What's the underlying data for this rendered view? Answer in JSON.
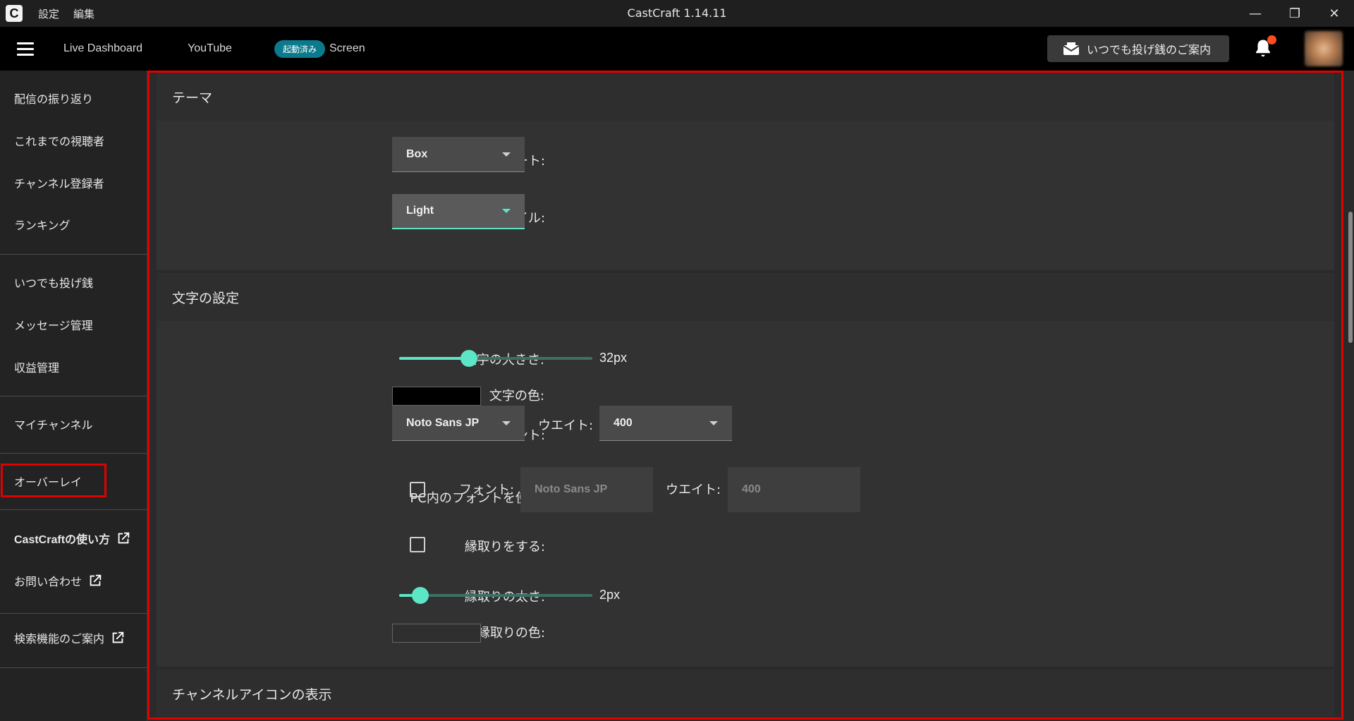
{
  "titlebar": {
    "logo_letter": "C",
    "menus": [
      "設定",
      "編集"
    ],
    "title": "CastCraft 1.14.11",
    "minimize": "—",
    "restore": "❐",
    "close": "✕"
  },
  "navbar": {
    "links": {
      "dashboard": "Live Dashboard",
      "youtube": "YouTube",
      "screen_badge": "起動済み",
      "screen": "Screen"
    },
    "donation_button": "いつでも投げ銭のご案内",
    "notification_dot_color": "#ff4d1f"
  },
  "sidebar": {
    "items": [
      {
        "label": "配信の振り返り"
      },
      {
        "label": "これまでの視聴者"
      },
      {
        "label": "チャンネル登録者"
      },
      {
        "label": "ランキング"
      },
      {
        "label": "いつでも投げ銭"
      },
      {
        "label": "メッセージ管理"
      },
      {
        "label": "収益管理"
      },
      {
        "label": "マイチャンネル"
      },
      {
        "label": "オーバーレイ"
      },
      {
        "label": "CastCraftの使い方"
      },
      {
        "label": "お問い合わせ"
      },
      {
        "label": "検索機能のご案内"
      }
    ]
  },
  "theme": {
    "title": "テーマ",
    "base_template_label": "ベーステンプレート:",
    "base_template_value": "Box",
    "base_style_label": "ベーススタイル:",
    "base_style_value": "Light"
  },
  "text_settings": {
    "title": "文字の設定",
    "size_label": "文字の大きさ:",
    "size_value": "32px",
    "size_fraction": 0.36,
    "color_label": "文字の色:",
    "text_color": "#000000",
    "font_label": "フォント:",
    "font_value": "Noto Sans JP",
    "weight_label": "ウエイト:",
    "weight_value": "400",
    "pc_font_label": "PC内のフォントを使う:",
    "pc_font_font_label": "フォント:",
    "pc_font_font_placeholder": "Noto Sans JP",
    "pc_font_weight_label": "ウエイト:",
    "pc_font_weight_placeholder": "400",
    "outline_label": "縁取りをする:",
    "outline_width_label": "縁取りの太さ:",
    "outline_width_value": "2px",
    "outline_width_fraction": 0.11,
    "outline_color_label": "縁取りの色:",
    "outline_color": "#2f2f2f"
  },
  "channel_icon": {
    "title": "チャンネルアイコンの表示"
  },
  "colors": {
    "accent": "#5ce6c6",
    "highlight_border": "#e00000",
    "badge": "#0b7a8c"
  }
}
